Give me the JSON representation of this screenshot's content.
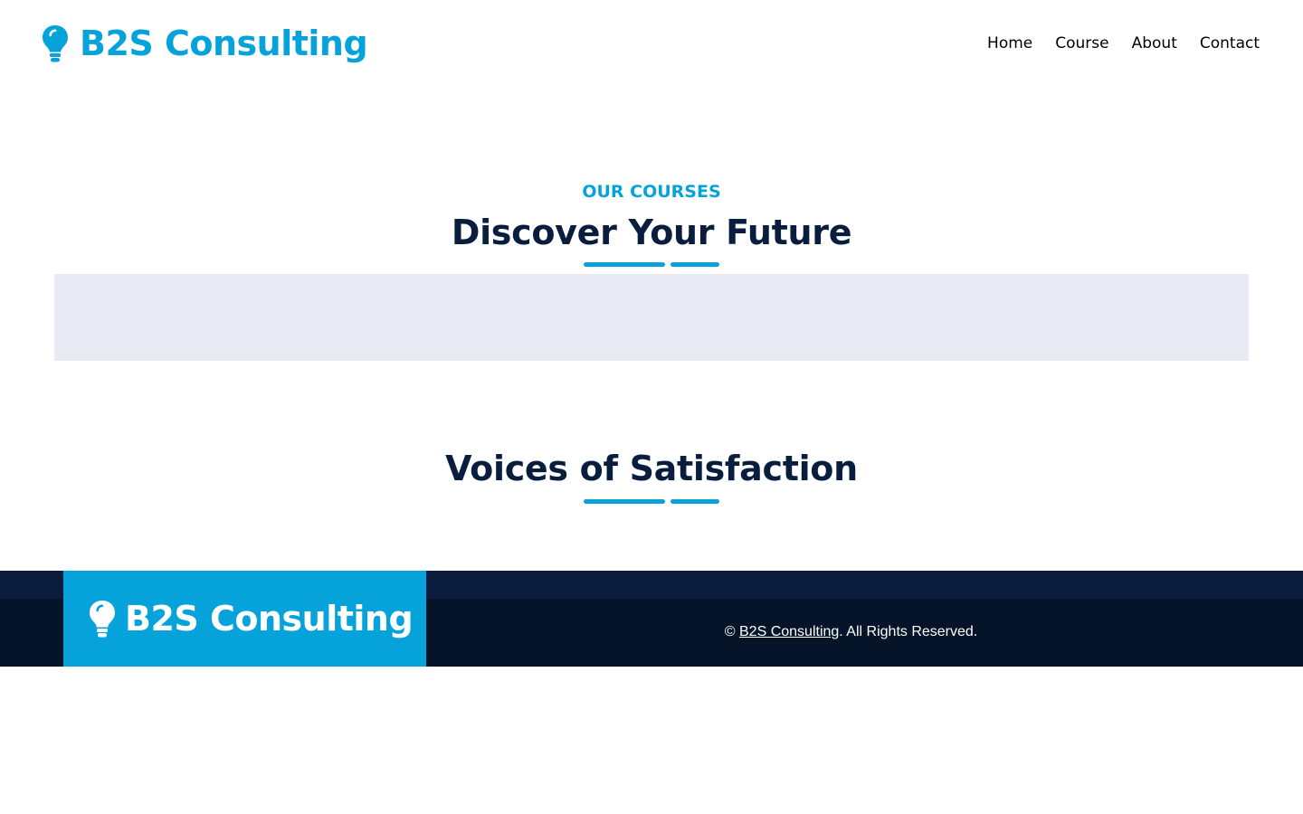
{
  "header": {
    "brand": "B2S Consulting",
    "nav": [
      "Home",
      "Course",
      "About",
      "Contact"
    ]
  },
  "courses": {
    "kicker": "OUR COURSES",
    "title": "Discover Your Future"
  },
  "testimonials": {
    "title": "Voices of Satisfaction"
  },
  "footer": {
    "brand": "B2S Consulting",
    "copyright_prefix": "©",
    "copyright_link": "B2S Consulting",
    "copyright_suffix": ". All Rights Reserved."
  },
  "colors": {
    "accent": "#06a3da",
    "dark_navy": "#091e3e",
    "panel_bg": "#e9eaf3",
    "footer_top": "#0b1c3e",
    "footer_bottom": "#061429"
  },
  "icons": {
    "brand": "lightbulb-icon"
  }
}
